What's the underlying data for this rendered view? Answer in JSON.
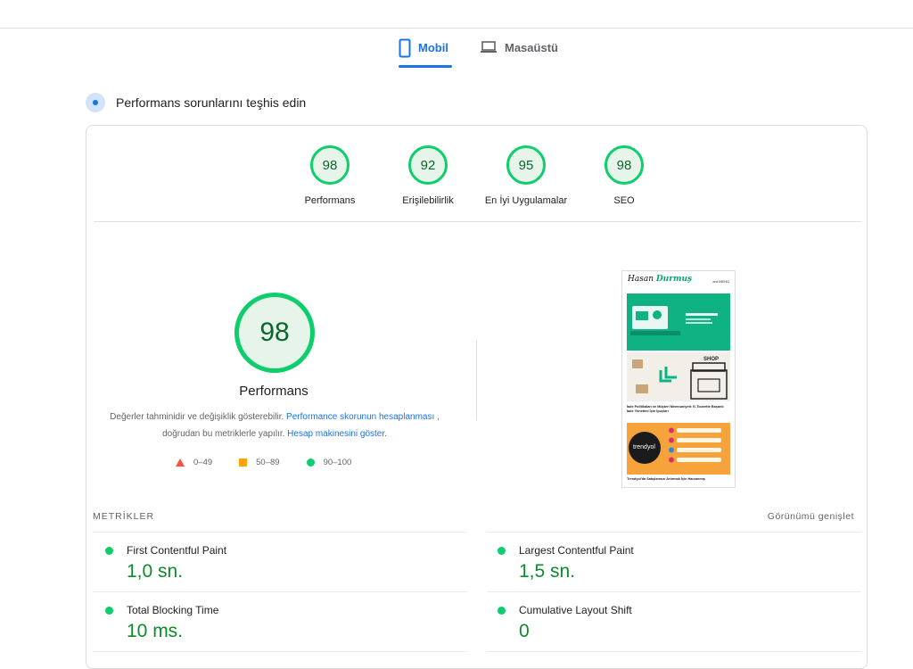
{
  "tabs": [
    {
      "label": "Mobil",
      "icon": "phone-icon",
      "active": true
    },
    {
      "label": "Masaüstü",
      "icon": "laptop-icon",
      "active": false
    }
  ],
  "diagnose_title": "Performans sorunlarını teşhis edin",
  "categories": [
    {
      "score": "98",
      "label": "Performans"
    },
    {
      "score": "92",
      "label": "Erişilebilirlik"
    },
    {
      "score": "95",
      "label": "En İyi Uygulamalar"
    },
    {
      "score": "98",
      "label": "SEO"
    }
  ],
  "performance": {
    "score": "98",
    "label": "Performans",
    "desc_1": "Değerler tahminidir ve değişiklik gösterebilir.",
    "link_1": "Performance skorunun hesaplanması",
    "desc_2": ", doğrudan bu metriklerle yapılır.",
    "link_2": "Hesap makinesini göster."
  },
  "legend": [
    {
      "range": "0–49",
      "color": "#ff4e42",
      "shape": "triangle"
    },
    {
      "range": "50–89",
      "color": "#ffa400",
      "shape": "square"
    },
    {
      "range": "90–100",
      "color": "#0cce6b",
      "shape": "circle"
    }
  ],
  "screenshot": {
    "logo_1": "Hasan",
    "logo_2": "Durmuş",
    "tag": "ara  MENÜ",
    "text": "İade Politikaları ve Müşteri Memnuniyeti: E-Ticarette Başarılı İade Yönetimi İçin İpuçları",
    "brand": "trendyol",
    "shop": "SHOP",
    "foot": "Trendyol'da Satışlarınızı Artırmak İçin Harcanmış"
  },
  "metrics_heading": "METRİKLER",
  "expand_label": "Görünümü genişlet",
  "metrics": [
    {
      "name": "First Contentful Paint",
      "value": "1,0 sn."
    },
    {
      "name": "Largest Contentful Paint",
      "value": "1,5 sn."
    },
    {
      "name": "Total Blocking Time",
      "value": "10 ms."
    },
    {
      "name": "Cumulative Layout Shift",
      "value": "0"
    }
  ],
  "colors": {
    "accent": "#1a73e8",
    "pass": "#0cce6b",
    "pass_text": "#0d8a2c"
  }
}
